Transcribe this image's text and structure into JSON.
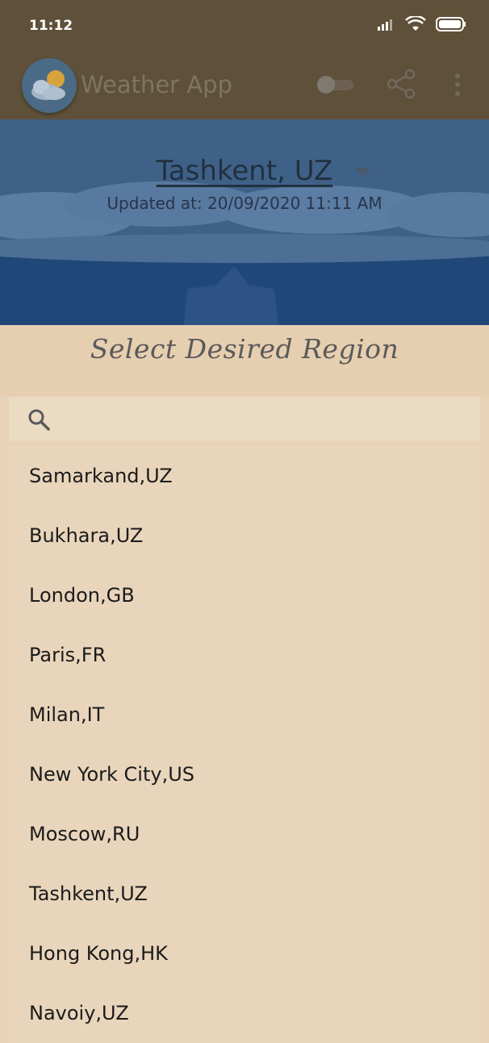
{
  "status_bar": {
    "time": "11:12"
  },
  "app_bar": {
    "title": "Weather App"
  },
  "location": {
    "city": "Tashkent, UZ",
    "updated": "Updated at: 20/09/2020 11:11 AM"
  },
  "region_dialog": {
    "title": "Select Desired Region",
    "search": {
      "placeholder": ""
    },
    "regions": [
      {
        "label": "Samarkand,UZ"
      },
      {
        "label": "Bukhara,UZ"
      },
      {
        "label": "London,GB"
      },
      {
        "label": "Paris,FR"
      },
      {
        "label": "Milan,IT"
      },
      {
        "label": "New York City,US"
      },
      {
        "label": "Moscow,RU"
      },
      {
        "label": "Tashkent,UZ"
      },
      {
        "label": "Hong Kong,HK"
      },
      {
        "label": "Navoiy,UZ"
      }
    ]
  },
  "colors": {
    "app_bar": "#5f5039",
    "hero_sky": "#3c5d82",
    "sheet": "#e8d3b9"
  }
}
